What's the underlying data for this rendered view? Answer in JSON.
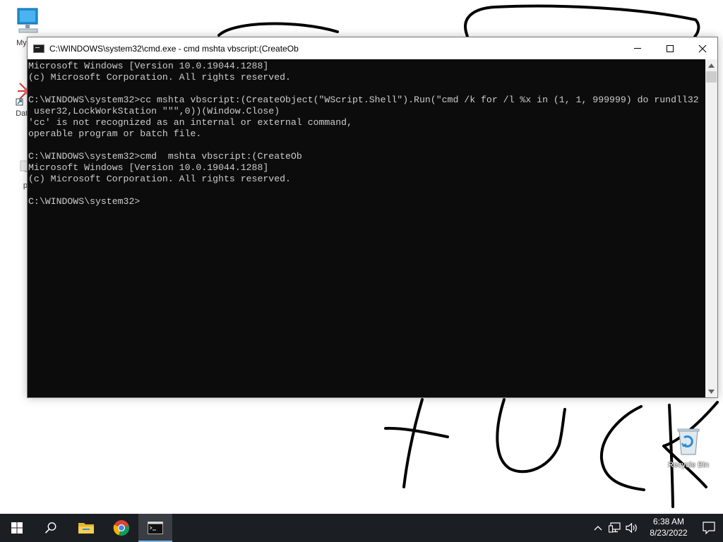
{
  "desktop": {
    "icons": [
      {
        "label": "My Co"
      },
      {
        "label": "DataW"
      },
      {
        "label": "pe"
      },
      {
        "label": "Recycle Bin"
      }
    ]
  },
  "window": {
    "title": "C:\\WINDOWS\\system32\\cmd.exe - cmd   mshta vbscript:(CreateOb",
    "console_lines": [
      "Microsoft Windows [Version 10.0.19044.1288]",
      "(c) Microsoft Corporation. All rights reserved.",
      "",
      "C:\\WINDOWS\\system32>cc mshta vbscript:(CreateObject(\"WScript.Shell\").Run(\"cmd /k for /l %x in (1, 1, 999999) do rundll32",
      " user32,LockWorkStation \"\"\",0))(Window.Close)",
      "'cc' is not recognized as an internal or external command,",
      "operable program or batch file.",
      "",
      "C:\\WINDOWS\\system32>cmd  mshta vbscript:(CreateOb",
      "Microsoft Windows [Version 10.0.19044.1288]",
      "(c) Microsoft Corporation. All rights reserved.",
      "",
      "C:\\WINDOWS\\system32>"
    ],
    "controls": {
      "minimize": "minimize",
      "maximize": "maximize",
      "close": "close"
    }
  },
  "taskbar": {
    "apps": [
      {
        "icon": "windows-start-icon"
      },
      {
        "icon": "search-icon"
      },
      {
        "icon": "file-explorer-icon"
      },
      {
        "icon": "chrome-icon"
      },
      {
        "icon": "command-prompt-icon",
        "active": true
      }
    ],
    "clock": {
      "time": "6:38 AM",
      "date": "8/23/2022"
    }
  },
  "colors": {
    "console_bg": "#0c0c0c",
    "console_text": "#cccccc",
    "taskbar_bg": "#1b1f24",
    "active_indicator": "#76b9ed"
  }
}
